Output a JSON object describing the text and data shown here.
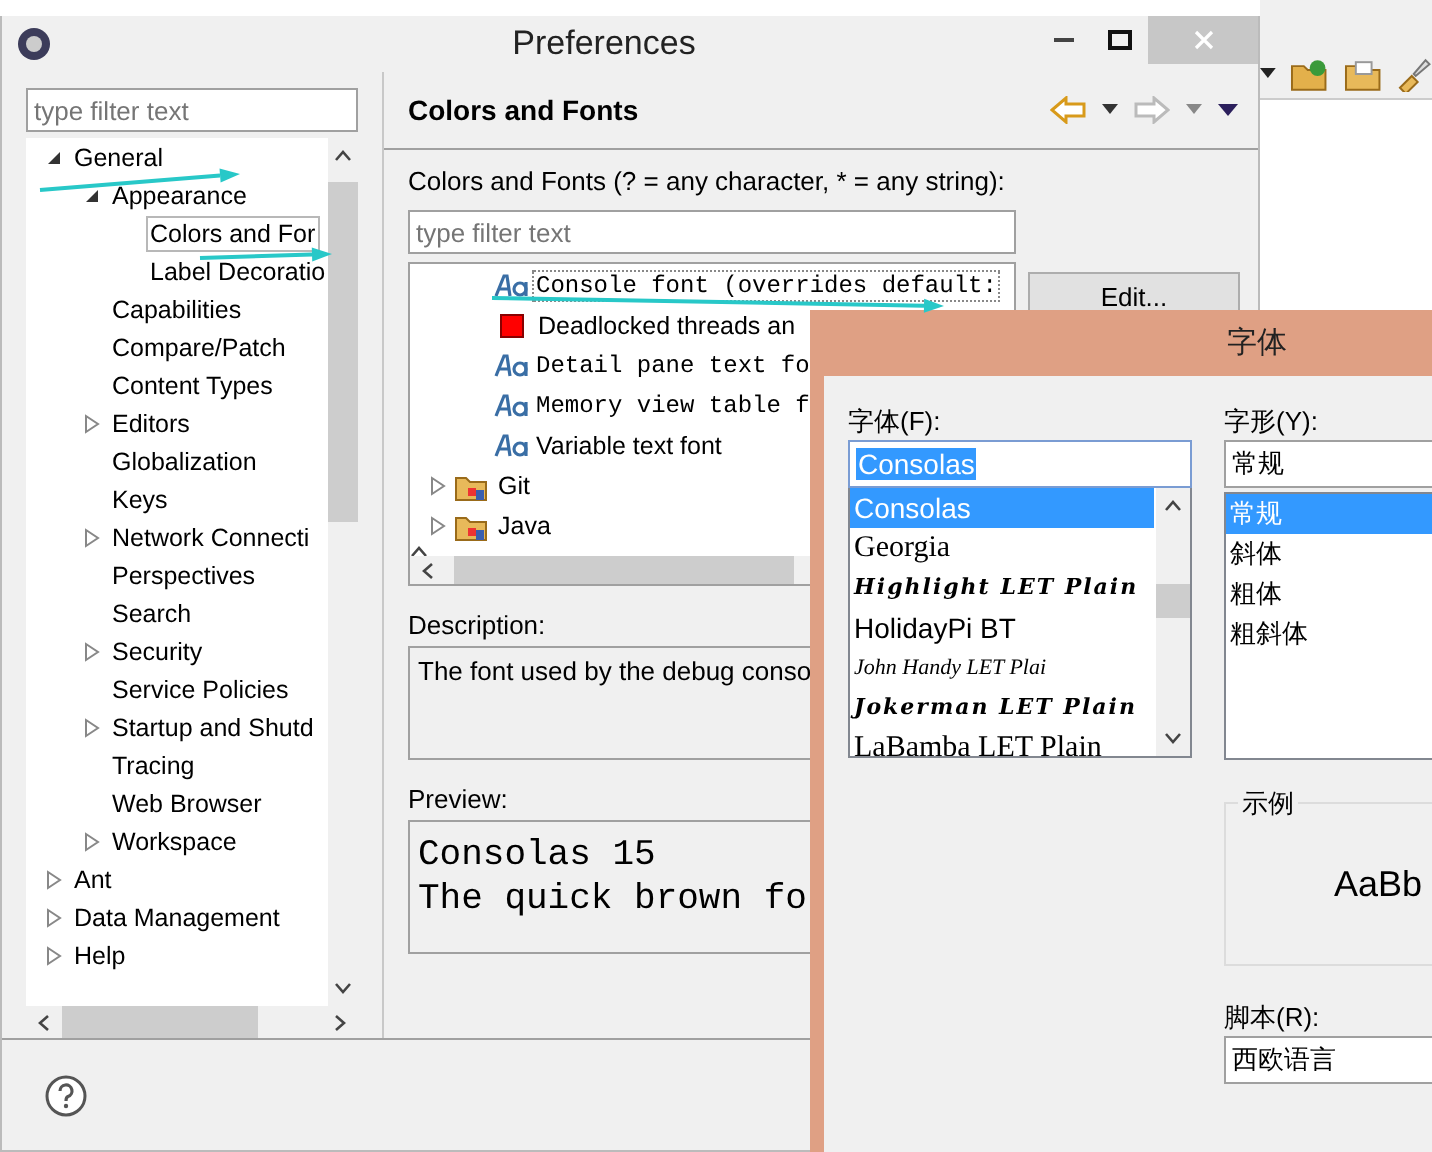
{
  "preferences": {
    "title": "Preferences",
    "filter": {
      "placeholder": "type filter text"
    },
    "tree": [
      {
        "label": "General",
        "expandable": true,
        "expanded": true,
        "selected": false,
        "children": [
          {
            "label": "Appearance",
            "expandable": true,
            "expanded": true,
            "selected": false,
            "children": [
              {
                "label": "Colors and For",
                "expandable": false,
                "selected": true
              },
              {
                "label": "Label Decoratio",
                "expandable": false,
                "selected": false
              }
            ]
          },
          {
            "label": "Capabilities",
            "expandable": false,
            "selected": false
          },
          {
            "label": "Compare/Patch",
            "expandable": false,
            "selected": false
          },
          {
            "label": "Content Types",
            "expandable": false,
            "selected": false
          },
          {
            "label": "Editors",
            "expandable": true,
            "expanded": false,
            "selected": false
          },
          {
            "label": "Globalization",
            "expandable": false,
            "selected": false
          },
          {
            "label": "Keys",
            "expandable": false,
            "selected": false
          },
          {
            "label": "Network Connecti",
            "expandable": true,
            "expanded": false,
            "selected": false
          },
          {
            "label": "Perspectives",
            "expandable": false,
            "selected": false
          },
          {
            "label": "Search",
            "expandable": false,
            "selected": false
          },
          {
            "label": "Security",
            "expandable": true,
            "expanded": false,
            "selected": false
          },
          {
            "label": "Service Policies",
            "expandable": false,
            "selected": false
          },
          {
            "label": "Startup and Shutd",
            "expandable": true,
            "expanded": false,
            "selected": false
          },
          {
            "label": "Tracing",
            "expandable": false,
            "selected": false
          },
          {
            "label": "Web Browser",
            "expandable": false,
            "selected": false
          },
          {
            "label": "Workspace",
            "expandable": true,
            "expanded": false,
            "selected": false
          }
        ]
      },
      {
        "label": "Ant",
        "expandable": true,
        "expanded": false,
        "selected": false
      },
      {
        "label": "Data Management",
        "expandable": true,
        "expanded": false,
        "selected": false
      },
      {
        "label": "Help",
        "expandable": true,
        "expanded": false,
        "selected": false
      }
    ],
    "page": {
      "title": "Colors and Fonts",
      "hint": "Colors and Fonts (? = any character, * = any string):",
      "filter": {
        "placeholder": "type filter text"
      },
      "items": [
        {
          "label": "Console font (overrides default:",
          "kind": "font",
          "selected": true,
          "proportional": false
        },
        {
          "label": "Deadlocked threads an",
          "kind": "color",
          "selected": false,
          "proportional": true,
          "color": "#ff0000"
        },
        {
          "label": "Detail pane text fo",
          "kind": "font",
          "selected": false,
          "proportional": false
        },
        {
          "label": "Memory view table f",
          "kind": "font",
          "selected": false,
          "proportional": false
        },
        {
          "label": "Variable text font",
          "kind": "font",
          "selected": false,
          "proportional": true
        },
        {
          "label": "Git",
          "kind": "category",
          "selected": false,
          "proportional": true,
          "expanded": false
        },
        {
          "label": "Java",
          "kind": "category",
          "selected": false,
          "proportional": true,
          "expanded": false
        }
      ],
      "edit_button": "Edit...",
      "description_label": "Description:",
      "description": "The font used by the debug conso",
      "preview_label": "Preview:",
      "preview": [
        "Consolas 15",
        "The quick brown fo"
      ]
    }
  },
  "font_dialog": {
    "title": "字体",
    "font_label": "字体(F):",
    "font_value": "Consolas",
    "fonts": [
      {
        "name": "Consolas",
        "kind": "plain",
        "selected": true
      },
      {
        "name": "Georgia",
        "kind": "serif",
        "selected": false
      },
      {
        "name": "Highlight LET Plain",
        "kind": "decorative",
        "selected": false
      },
      {
        "name": "HolidayPi BT",
        "kind": "plain",
        "selected": false
      },
      {
        "name": "John Handy LET Plai",
        "kind": "script",
        "selected": false
      },
      {
        "name": "Jokerman LET Plain",
        "kind": "decorative",
        "selected": false
      },
      {
        "name": "LaBamba LET Plain",
        "kind": "serif",
        "selected": false
      }
    ],
    "style_label": "字形(Y):",
    "style_value": "常规",
    "styles": [
      {
        "name": "常规",
        "selected": true
      },
      {
        "name": "斜体",
        "selected": false
      },
      {
        "name": "粗体",
        "selected": false
      },
      {
        "name": "粗斜体",
        "selected": false
      }
    ],
    "sample_label": "示例",
    "sample_text": "AaBb",
    "script_label": "脚本(R):",
    "script_value": "西欧语言"
  }
}
